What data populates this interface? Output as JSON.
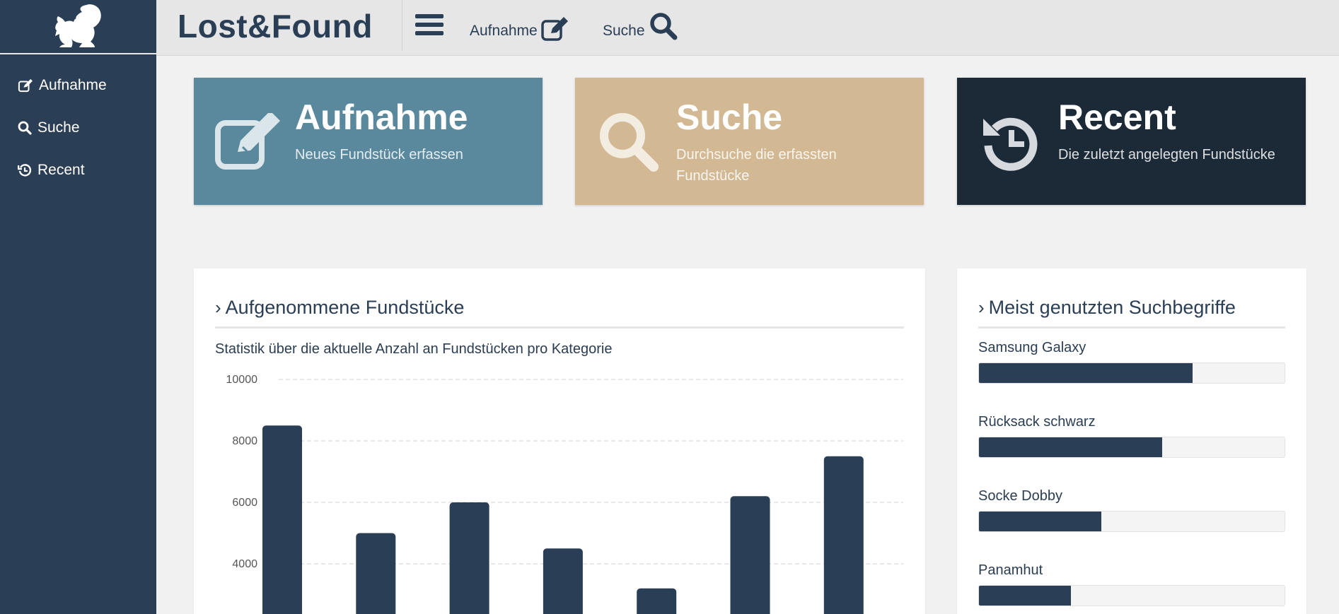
{
  "app": {
    "brand": "Lost&Found"
  },
  "colors": {
    "navy": "#2a3e55",
    "steel_blue": "#5a889d",
    "sand": "#d2b993",
    "dark": "#1c2937"
  },
  "sidebar": {
    "logo_icon": "squirrel-icon",
    "items": [
      {
        "label": "Aufnahme",
        "icon": "edit-icon"
      },
      {
        "label": "Suche",
        "icon": "search-icon"
      },
      {
        "label": "Recent",
        "icon": "history-icon"
      }
    ]
  },
  "topbar": {
    "menu_icon": "hamburger-icon",
    "links": [
      {
        "label": "Aufnahme",
        "icon": "edit-icon"
      },
      {
        "label": "Suche",
        "icon": "search-icon"
      }
    ]
  },
  "tiles": [
    {
      "title": "Aufnahme",
      "subtitle": "Neues Fundstück erfassen",
      "icon": "edit-icon",
      "color": "#5a889d"
    },
    {
      "title": "Suche",
      "subtitle_line1": "Durchsuche die erfassten",
      "subtitle_line2": "Fundstücke",
      "icon": "search-icon",
      "color": "#d2b993"
    },
    {
      "title": "Recent",
      "subtitle": "Die zuletzt angelegten Fundstücke",
      "icon": "history-icon",
      "color": "#1c2937"
    }
  ],
  "stats_panel": {
    "title": "Aufgenommene Fundstücke",
    "description": "Statistik über die aktuelle Anzahl an Fundstücken pro Kategorie"
  },
  "chart_data": {
    "type": "bar",
    "title": "",
    "xlabel": "",
    "ylabel": "",
    "y_ticks": [
      "10000",
      "8000",
      "6000",
      "4000"
    ],
    "ylim": [
      0,
      10000
    ],
    "grid": true,
    "values": [
      8500,
      5000,
      6000,
      4500,
      3200,
      6200,
      7500
    ],
    "bar_color": "#2a3e55"
  },
  "search_panel": {
    "title": "Meist genutzten Suchbegriffe",
    "terms": [
      {
        "label": "Samsung Galaxy",
        "fraction": 0.7
      },
      {
        "label": "Rücksack schwarz",
        "fraction": 0.6
      },
      {
        "label": "Socke Dobby",
        "fraction": 0.4
      },
      {
        "label": "Panamhut",
        "fraction": 0.3
      }
    ]
  }
}
